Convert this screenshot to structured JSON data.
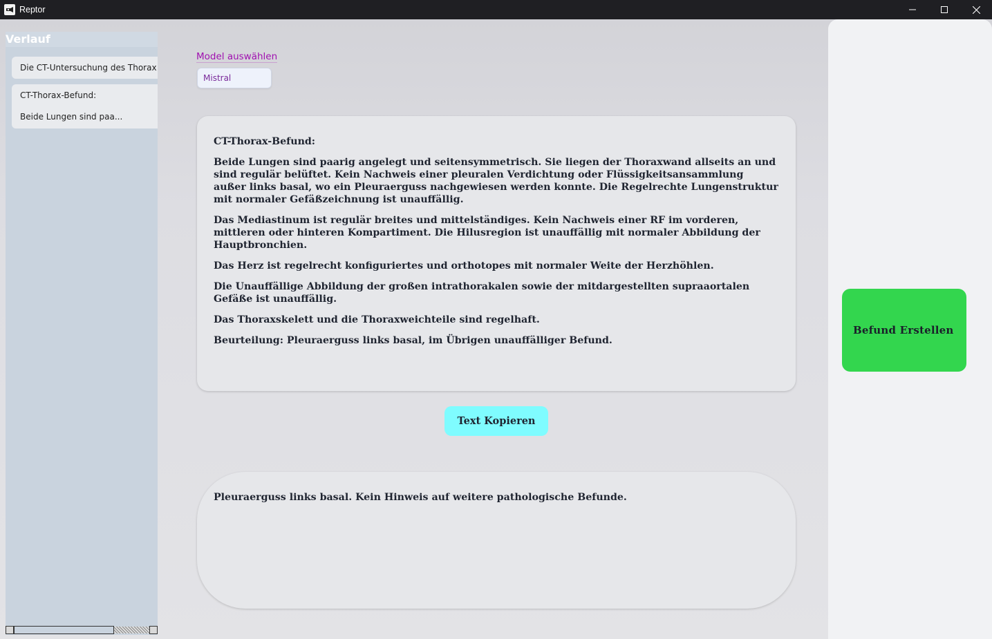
{
  "window": {
    "title": "Reptor"
  },
  "sidebar": {
    "title": "Verlauf",
    "items": [
      {
        "label": "Die CT-Untersuchung des Thorax z"
      },
      {
        "line1": "CT-Thorax-Befund:",
        "line2": "Beide Lungen sind paa..."
      }
    ]
  },
  "model": {
    "label": "Model auswählen",
    "selected": "Mistral"
  },
  "report": {
    "paragraphs": [
      "CT-Thorax-Befund:",
      "Beide Lungen sind paarig angelegt und seitensymmetrisch. Sie liegen der Thoraxwand allseits an und sind regulär belüftet. Kein Nachweis einer pleuralen Verdichtung oder Flüssigkeitsansammlung außer links basal, wo ein Pleuraerguss nachgewiesen werden konnte. Die Regelrechte Lungenstruktur mit normaler Gefäßzeichnung ist unauffällig.",
      "Das Mediastinum ist regulär breites und mittelständiges. Kein Nachweis einer RF im vorderen, mittleren oder hinteren Kompartiment. Die Hilusregion ist unauffällig mit normaler Abbildung der Hauptbronchien.",
      "Das Herz ist regelrecht konfiguriertes und orthotopes mit normaler Weite der Herzhöhlen.",
      "Die Unauffällige Abbildung der großen intrathorakalen sowie der mitdargestellten supraaortalen Gefäße ist unauffällig.",
      "Das Thoraxskelett und die Thoraxweichteile sind regelhaft.",
      "Beurteilung: Pleuraerguss links basal, im Übrigen unauffälliger Befund."
    ]
  },
  "actions": {
    "copy_label": "Text Kopieren",
    "create_label": "Befund Erstellen"
  },
  "summary": {
    "text": "Pleuraerguss links basal. Kein Hinweis auf weitere pathologische Befunde."
  },
  "colors": {
    "create_button": "#33d64e",
    "copy_button": "#7ffcff",
    "model_label": "#a010b0"
  }
}
